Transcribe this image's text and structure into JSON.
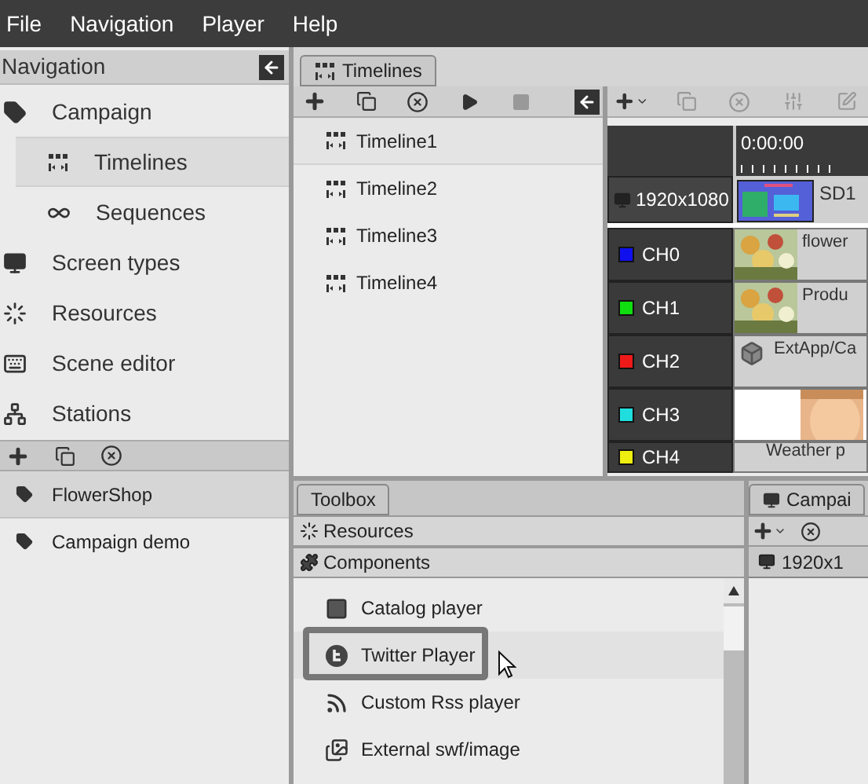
{
  "menu": [
    "File",
    "Navigation",
    "Player",
    "Help"
  ],
  "navigation": {
    "title": "Navigation",
    "items": [
      {
        "label": "Campaign",
        "kind": "tag",
        "selected": false,
        "children": [
          {
            "label": "Timelines",
            "kind": "timeline",
            "selected": true
          },
          {
            "label": "Sequences",
            "kind": "infinity",
            "selected": false
          }
        ]
      },
      {
        "label": "Screen types",
        "kind": "monitor",
        "selected": false
      },
      {
        "label": "Resources",
        "kind": "dots",
        "selected": false
      },
      {
        "label": "Scene editor",
        "kind": "keyboard",
        "selected": false
      },
      {
        "label": "Stations",
        "kind": "network",
        "selected": false
      }
    ]
  },
  "campaigns": [
    {
      "label": "FlowerShop",
      "selected": true
    },
    {
      "label": "Campaign demo",
      "selected": false
    }
  ],
  "timelines_panel": {
    "tab": "Timelines",
    "items": [
      {
        "label": "Timeline1",
        "selected": true
      },
      {
        "label": "Timeline2",
        "selected": false
      },
      {
        "label": "Timeline3",
        "selected": false
      },
      {
        "label": "Timeline4",
        "selected": false
      }
    ]
  },
  "timeline_editor": {
    "time": "0:00:00",
    "screen": "1920x1080",
    "screen_clip": "SD1",
    "channels": [
      {
        "name": "CH0",
        "color": "#1010ee",
        "kind": "picture",
        "clip": "flower"
      },
      {
        "name": "CH1",
        "color": "#10dd10",
        "kind": "picture",
        "clip": "Produ"
      },
      {
        "name": "CH2",
        "color": "#ee1a1a",
        "kind": "app",
        "clip": "ExtApp/Ca"
      },
      {
        "name": "CH3",
        "color": "#20dede",
        "kind": "offset_picture"
      },
      {
        "name": "CH4",
        "color": "#eeee10",
        "kind": "weather",
        "clip": "Weather p"
      }
    ]
  },
  "toolbox": {
    "tab": "Toolbox",
    "sections": [
      "Resources",
      "Components"
    ],
    "items": [
      {
        "label": "Catalog player",
        "kind": "catalog",
        "selected": false
      },
      {
        "label": "Twitter Player",
        "kind": "twitter",
        "selected": true
      },
      {
        "label": "Custom Rss player",
        "kind": "rss",
        "selected": false
      },
      {
        "label": "External swf/image",
        "kind": "external",
        "selected": false
      }
    ]
  },
  "campaign_panel": {
    "tab": "Campai",
    "screen": "1920x1"
  }
}
